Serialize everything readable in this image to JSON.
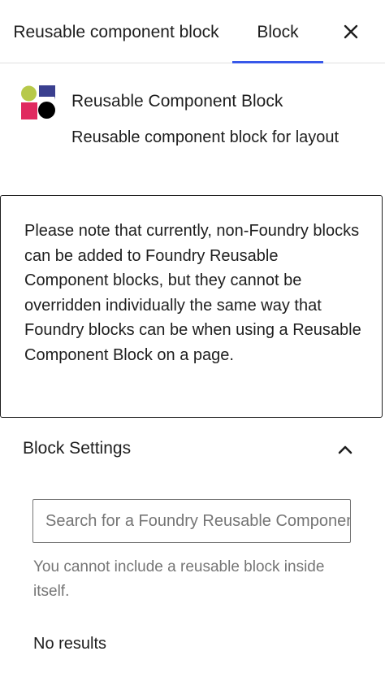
{
  "header": {
    "tabs": [
      {
        "label": "Reusable component block"
      },
      {
        "label": "Block",
        "active": true
      }
    ],
    "close_icon": "close-icon"
  },
  "block_card": {
    "icon": "foundry-block-icon",
    "title": "Reusable Component Block",
    "description": "Reusable component block for layout"
  },
  "notice": {
    "text": "Please note that currently, non-Foundry blocks can be added to Foundry Reusable Component blocks, but they cannot be overridden individually the same way that Foundry blocks can be when using a Reusable Component Block on a page."
  },
  "settings_panel": {
    "title": "Block Settings",
    "expanded": true,
    "toggle_icon": "chevron-up-icon",
    "search": {
      "placeholder": "Search for a Foundry Reusable Component",
      "value": ""
    },
    "help_text": "You cannot include a reusable block inside itself.",
    "results_text": "No results"
  },
  "colors": {
    "accent": "#3858e9",
    "text": "#1e1e1e",
    "muted_text": "#757575",
    "logo_green": "#b7c94a",
    "logo_navy": "#3a3f8f",
    "logo_pink": "#e0295f",
    "logo_black": "#000000"
  }
}
